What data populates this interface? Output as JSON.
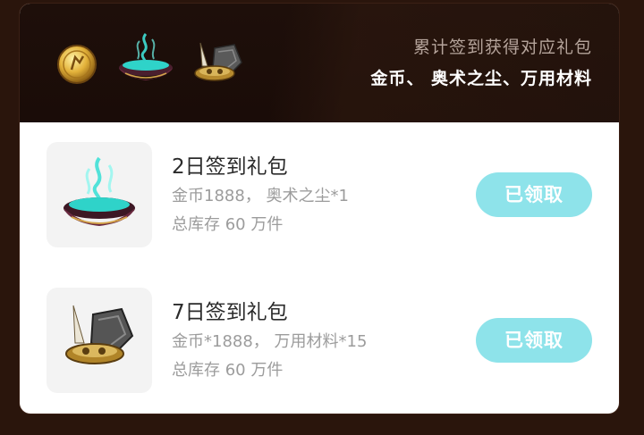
{
  "header": {
    "line1": "累计签到获得对应礼包",
    "line2": "金币、 奥术之尘、万用材料",
    "icons": [
      "gold-coin-icon",
      "arcane-dust-icon",
      "universal-material-icon"
    ]
  },
  "gifts": [
    {
      "title": "2日签到礼包",
      "desc": "金币1888， 奥术之尘*1",
      "stock": "总库存 60 万件",
      "button": "已领取",
      "icon": "arcane-dust-icon"
    },
    {
      "title": "7日签到礼包",
      "desc": "金币*1888， 万用材料*15",
      "stock": "总库存 60 万件",
      "button": "已领取",
      "icon": "universal-material-icon"
    }
  ],
  "colors": {
    "background": "#2a150c",
    "header": "#1e0f0a",
    "claimed_button": "#8ee3ea"
  }
}
